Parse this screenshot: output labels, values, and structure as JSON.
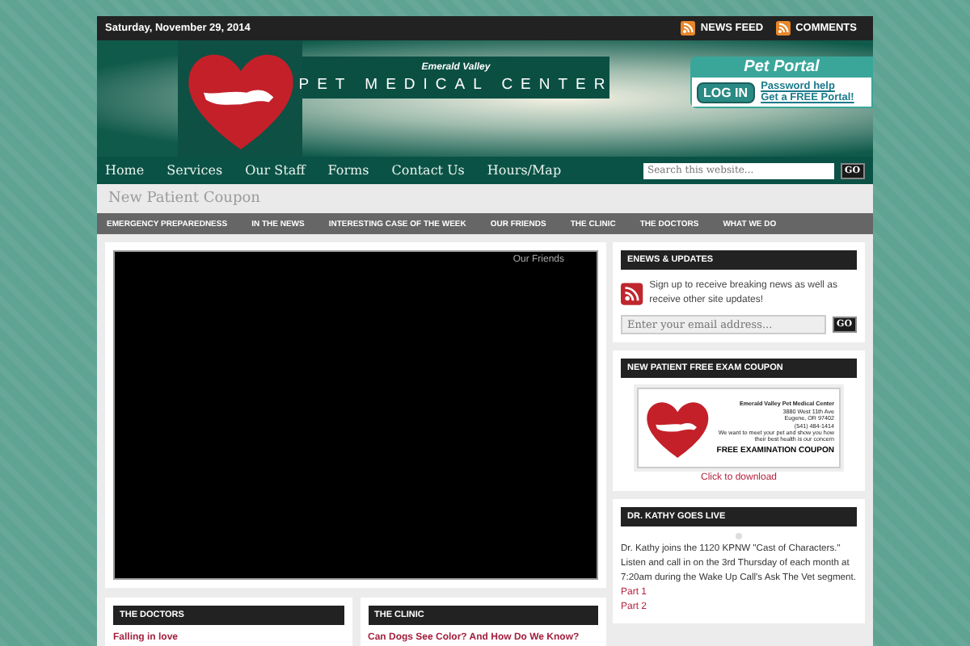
{
  "top_bar": {
    "date": "Saturday, November 29, 2014",
    "links": [
      {
        "label": "NEWS FEED"
      },
      {
        "label": "COMMENTS"
      }
    ]
  },
  "header": {
    "tagline": "Emerald Valley",
    "title": "PET MEDICAL CENTER",
    "portal": {
      "title": "Pet Portal",
      "button": "LOG IN",
      "links": [
        "Password help",
        "Get a FREE Portal!"
      ]
    }
  },
  "nav": {
    "items": [
      {
        "label": "Home"
      },
      {
        "label": "Services"
      },
      {
        "label": "Our Staff"
      },
      {
        "label": "Forms"
      },
      {
        "label": "Contact Us"
      },
      {
        "label": "Hours/Map"
      }
    ],
    "search": {
      "placeholder": "Search this website...",
      "button": "GO"
    }
  },
  "page_title": "New Patient Coupon",
  "categories": [
    "EMERGENCY PREPAREDNESS",
    "IN THE NEWS",
    "INTERESTING CASE OF THE WEEK",
    "OUR FRIENDS",
    "THE CLINIC",
    "THE DOCTORS",
    "WHAT WE DO"
  ],
  "slider": {
    "caption": "Our Friends"
  },
  "bottom_cards": [
    {
      "title": "THE DOCTORS",
      "link": "Falling in love"
    },
    {
      "title": "THE CLINIC",
      "link": "Can Dogs See Color? And How Do We Know?"
    }
  ],
  "sidebar": {
    "enews": {
      "title": "ENEWS & UPDATES",
      "text": "Sign up to receive breaking news as well as receive other site updates!",
      "placeholder": "Enter your email address...",
      "button": "GO"
    },
    "coupon": {
      "title": "NEW PATIENT FREE EXAM COUPON",
      "image_lines": [
        "Emerald Valley Pet Medical Center",
        "3880 West 11th Ave",
        "Eugene, OR 97402",
        "(541) 484-1414",
        "We want to meet your pet and show you how their best health is our concern"
      ],
      "image_heading": "FREE EXAMINATION COUPON",
      "link": "Click to download"
    },
    "live": {
      "title": "DR. KATHY GOES LIVE",
      "text": "Dr. Kathy joins the 1120 KPNW \"Cast of Characters.\" Listen and call in on the 3rd Thursday of each month at 7:20am during the Wake Up Call's Ask The Vet segment.",
      "links": [
        "Part 1",
        "Part 2"
      ]
    }
  }
}
